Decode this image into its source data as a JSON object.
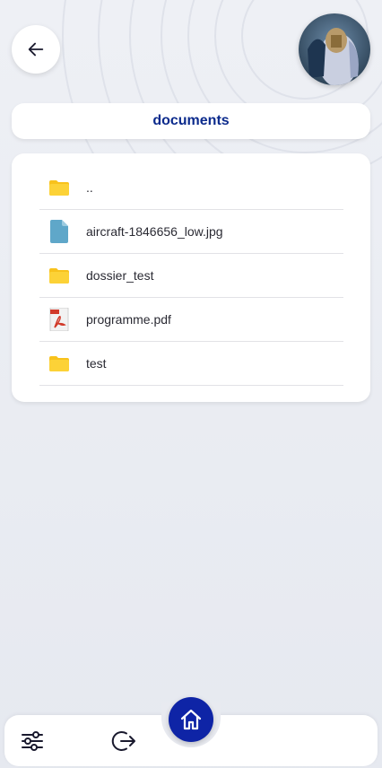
{
  "header": {
    "back_icon": "arrow-left-icon",
    "avatar_icon": "user-avatar"
  },
  "folder": {
    "title": "documents"
  },
  "files": [
    {
      "name": "..",
      "icon": "folder-icon"
    },
    {
      "name": "aircraft-1846656_low.jpg",
      "icon": "image-file-icon"
    },
    {
      "name": "dossier_test",
      "icon": "folder-icon"
    },
    {
      "name": "programme.pdf",
      "icon": "pdf-file-icon"
    },
    {
      "name": "test",
      "icon": "folder-icon"
    }
  ],
  "nav": {
    "settings_icon": "sliders-icon",
    "logout_icon": "logout-icon",
    "home_icon": "home-icon"
  },
  "colors": {
    "accent": "#0e24a6",
    "title": "#0b2a8c",
    "folder": "#f8c21c",
    "image_file": "#5fa7c9",
    "pdf": "#d13a2a"
  }
}
